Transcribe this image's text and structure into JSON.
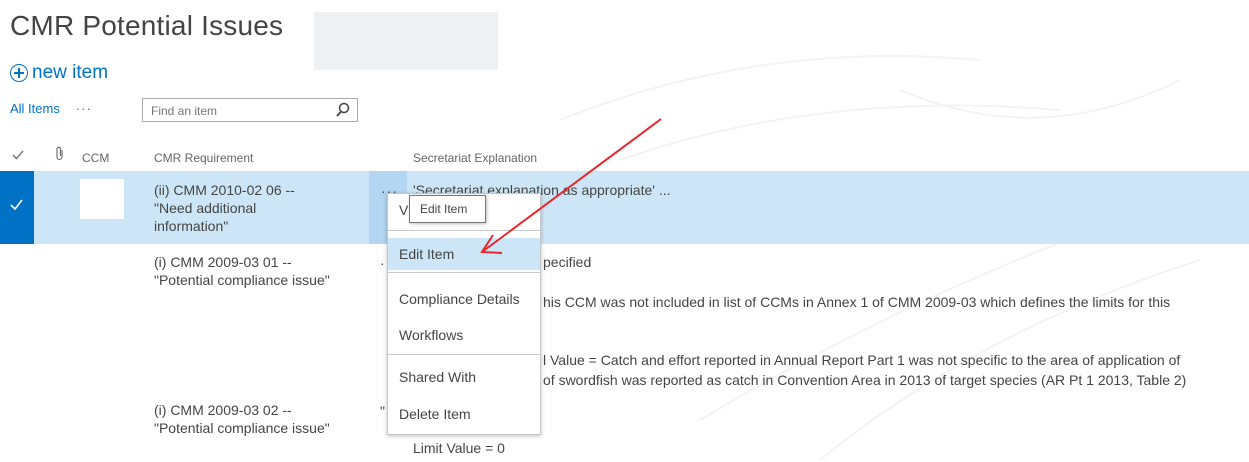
{
  "page": {
    "title": "CMR Potential Issues"
  },
  "toolbar": {
    "new_item_label": "new item"
  },
  "views": {
    "all_items_label": "All Items",
    "more_label": "···"
  },
  "search": {
    "placeholder": "Find an item"
  },
  "columns": {
    "ccm": "CCM",
    "cmr_requirement": "CMR Requirement",
    "secretariat_explanation": "Secretariat Explanation"
  },
  "rows": [
    {
      "req_line1": "(ii) CMM 2010-02 06 --",
      "req_line2": "\"Need additional",
      "req_line3": "information\"",
      "explanation": "'Secretariat explanation as appropriate' ..."
    },
    {
      "req_line1": "(i) CMM 2009-03 01 --",
      "req_line2": "\"Potential compliance issue\"",
      "exp_line1": "pecified",
      "exp_line2": "his CCM was not included in list of CCMs in Annex 1 of CMM 2009-03 which defines the limits for this",
      "exp_line3": "l Value = Catch and effort reported in Annual Report Part 1 was not specific to the area of application of",
      "exp_line4": "of swordfish was reported as catch in Convention Area in 2013 of target species (AR Pt 1 2013, Table 2)"
    },
    {
      "req_line1": "(i) CMM 2009-03 02 --",
      "req_line2": "\"Potential compliance issue\"",
      "exp_line1": "Limit Value = 0"
    }
  ],
  "row_action": {
    "ellipsis": "···",
    "ellipsis_partial": "··",
    "ellipsis_row3": "\""
  },
  "menu": {
    "partial_first_item": "V",
    "items": [
      "Edit Item",
      "Compliance Details",
      "Workflows",
      "Shared With",
      "Delete Item"
    ]
  },
  "tooltip": {
    "text": "Edit Item"
  },
  "colors": {
    "accent": "#0072c6",
    "selected_row": "#cde6f7",
    "annotation_arrow": "#e8262b"
  }
}
